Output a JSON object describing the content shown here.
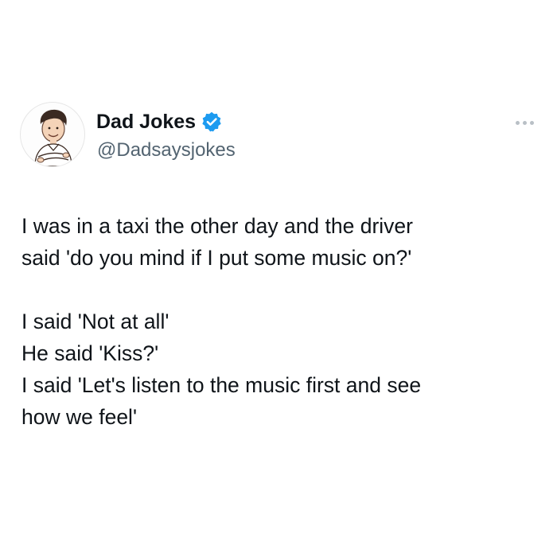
{
  "author": {
    "display_name": "Dad Jokes",
    "handle": "@Dadsaysjokes",
    "verified": true,
    "avatar_icon": "cartoon-man-avatar",
    "verified_icon": "verified-badge-icon"
  },
  "more_icon": "more-options-icon",
  "tweet": {
    "paragraph1": [
      "I was in a taxi the other day and the driver",
      "said 'do you mind if I put some music on?'"
    ],
    "paragraph2": [
      "I said 'Not at all'",
      "He said 'Kiss?'",
      "I said 'Let's listen to the music first and see",
      "how we feel'"
    ]
  },
  "colors": {
    "text": "#0f1419",
    "handle": "#536471",
    "verified_badge": "#1d9bf0",
    "background": "#ffffff"
  }
}
